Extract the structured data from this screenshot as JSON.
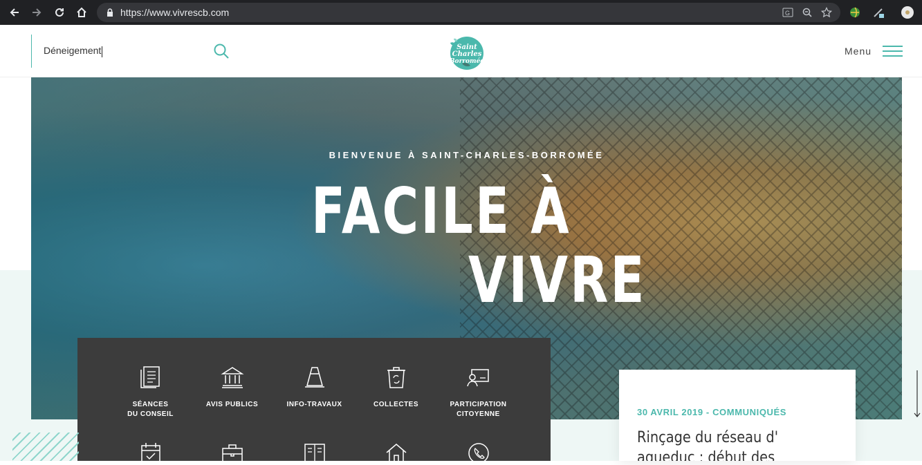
{
  "browser": {
    "url": "https://www.vivrescb.com"
  },
  "header": {
    "search_value": "Déneigement",
    "logo_text": "Saint Charles Borromée",
    "menu_label": "Menu"
  },
  "hero": {
    "kicker": "BIENVENUE À SAINT-CHARLES-BORROMÉE",
    "title_line1": "FACILE À",
    "title_line2": "VIVRE"
  },
  "quick_links": [
    {
      "label": "SÉANCES\nDU CONSEIL",
      "icon": "document-icon"
    },
    {
      "label": "AVIS PUBLICS",
      "icon": "bank-icon"
    },
    {
      "label": "INFO-TRAVAUX",
      "icon": "traffic-cone-icon"
    },
    {
      "label": "COLLECTES",
      "icon": "recycle-bin-icon"
    },
    {
      "label": "PARTICIPATION\nCITOYENNE",
      "icon": "citizen-screen-icon"
    },
    {
      "label": "",
      "icon": "calendar-icon"
    },
    {
      "label": "",
      "icon": "briefcase-icon"
    },
    {
      "label": "",
      "icon": "open-book-icon"
    },
    {
      "label": "",
      "icon": "house-icon"
    },
    {
      "label": "",
      "icon": "phone-icon"
    }
  ],
  "news": {
    "meta": "30 AVRIL 2019 - COMMUNIQUÉS",
    "headline": "Rinçage du réseau d' aqueduc : début des travaux"
  },
  "colors": {
    "accent": "#4bb8ac",
    "panel": "#3c3c3c",
    "mint": "#eef7f5"
  }
}
